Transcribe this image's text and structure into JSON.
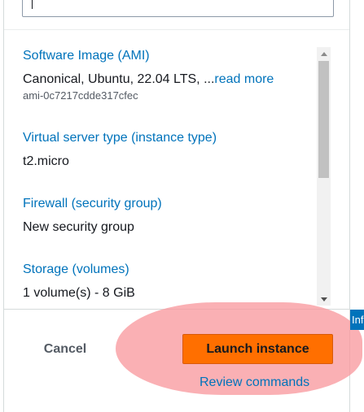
{
  "search": {
    "value": ""
  },
  "summary": {
    "items": [
      {
        "title": "Software Image (AMI)",
        "value": "Canonical, Ubuntu, 22.04 LTS, ...",
        "link": "read more",
        "sub": "ami-0c7217cdde317cfec"
      },
      {
        "title": "Virtual server type (instance type)",
        "value": "t2.micro"
      },
      {
        "title": "Firewall (security group)",
        "value": "New security group"
      },
      {
        "title": "Storage (volumes)",
        "value": "1 volume(s) - 8 GiB"
      }
    ]
  },
  "footer": {
    "cancel_label": "Cancel",
    "launch_label": "Launch instance",
    "review_label": "Review commands"
  },
  "side_badge": {
    "label": "Inf"
  },
  "colors": {
    "link": "#0073bb",
    "primary_button": "#ff6f00",
    "highlight": "#f8969b"
  }
}
